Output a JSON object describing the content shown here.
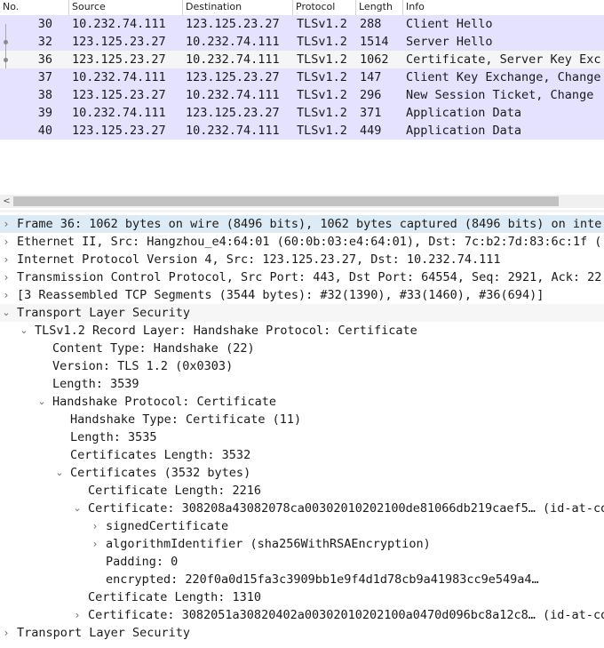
{
  "packet_list": {
    "columns": {
      "no": "No.",
      "source": "Source",
      "destination": "Destination",
      "protocol": "Protocol",
      "length": "Length",
      "info": "Info"
    },
    "rows": [
      {
        "no": "30",
        "source": "10.232.74.111",
        "destination": "123.125.23.27",
        "protocol": "TLSv1.2",
        "length": "288",
        "info": "Client Hello"
      },
      {
        "no": "32",
        "source": "123.125.23.27",
        "destination": "10.232.74.111",
        "protocol": "TLSv1.2",
        "length": "1514",
        "info": "Server Hello"
      },
      {
        "no": "36",
        "source": "123.125.23.27",
        "destination": "10.232.74.111",
        "protocol": "TLSv1.2",
        "length": "1062",
        "info": "Certificate, Server Key Exc"
      },
      {
        "no": "37",
        "source": "10.232.74.111",
        "destination": "123.125.23.27",
        "protocol": "TLSv1.2",
        "length": "147",
        "info": "Client Key Exchange, Change"
      },
      {
        "no": "38",
        "source": "123.125.23.27",
        "destination": "10.232.74.111",
        "protocol": "TLSv1.2",
        "length": "296",
        "info": "New Session Ticket, Change"
      },
      {
        "no": "39",
        "source": "10.232.74.111",
        "destination": "123.125.23.27",
        "protocol": "TLSv1.2",
        "length": "371",
        "info": "Application Data"
      },
      {
        "no": "40",
        "source": "123.125.23.27",
        "destination": "10.232.74.111",
        "protocol": "TLSv1.2",
        "length": "449",
        "info": "Application Data"
      }
    ]
  },
  "scrollbar": {
    "left_arrow": "<"
  },
  "details": [
    {
      "text": "Frame 36: 1062 bytes on wire (8496 bits), 1062 bytes captured (8496 bits) on inte",
      "state": "collapsed"
    },
    {
      "text": "Ethernet II, Src: Hangzhou_e4:64:01 (60:0b:03:e4:64:01), Dst: 7c:b2:7d:83:6c:1f (",
      "state": "collapsed"
    },
    {
      "text": "Internet Protocol Version 4, Src: 123.125.23.27, Dst: 10.232.74.111",
      "state": "collapsed"
    },
    {
      "text": "Transmission Control Protocol, Src Port: 443, Dst Port: 64554, Seq: 2921, Ack: 22",
      "state": "collapsed"
    },
    {
      "text": "[3 Reassembled TCP Segments (3544 bytes): #32(1390), #33(1460), #36(694)]",
      "state": "collapsed"
    },
    {
      "text": "Transport Layer Security",
      "state": "expanded"
    },
    {
      "text": "TLSv1.2 Record Layer: Handshake Protocol: Certificate",
      "state": "expanded"
    },
    {
      "text": "Content Type: Handshake (22)",
      "state": "leaf"
    },
    {
      "text": "Version: TLS 1.2 (0x0303)",
      "state": "leaf"
    },
    {
      "text": "Length: 3539",
      "state": "leaf"
    },
    {
      "text": "Handshake Protocol: Certificate",
      "state": "expanded"
    },
    {
      "text": "Handshake Type: Certificate (11)",
      "state": "leaf"
    },
    {
      "text": "Length: 3535",
      "state": "leaf"
    },
    {
      "text": "Certificates Length: 3532",
      "state": "leaf"
    },
    {
      "text": "Certificates (3532 bytes)",
      "state": "expanded"
    },
    {
      "text": "Certificate Length: 2216",
      "state": "leaf"
    },
    {
      "text": "Certificate: 308208a43082078ca00302010202100de81066db219caef5… (id-at-co",
      "state": "expanded"
    },
    {
      "text": "signedCertificate",
      "state": "collapsed"
    },
    {
      "text": "algorithmIdentifier (sha256WithRSAEncryption)",
      "state": "collapsed"
    },
    {
      "text": "Padding: 0",
      "state": "leaf"
    },
    {
      "text": "encrypted: 220f0a0d15fa3c3909bb1e9f4d1d78cb9a41983cc9e549a4…",
      "state": "leaf"
    },
    {
      "text": "Certificate Length: 1310",
      "state": "leaf"
    },
    {
      "text": "Certificate: 3082051a30820402a00302010202100a0470d096bc8a12c8… (id-at-co",
      "state": "collapsed"
    },
    {
      "text": "Transport Layer Security",
      "state": "collapsed"
    }
  ],
  "colors": {
    "tls_row_bg": "#e4e2ff",
    "selected_detail_bg": "#dcebf6",
    "header_border": "#d4d4d4"
  },
  "icons": {
    "collapsed": "chevron-right-icon",
    "expanded": "chevron-down-icon"
  }
}
